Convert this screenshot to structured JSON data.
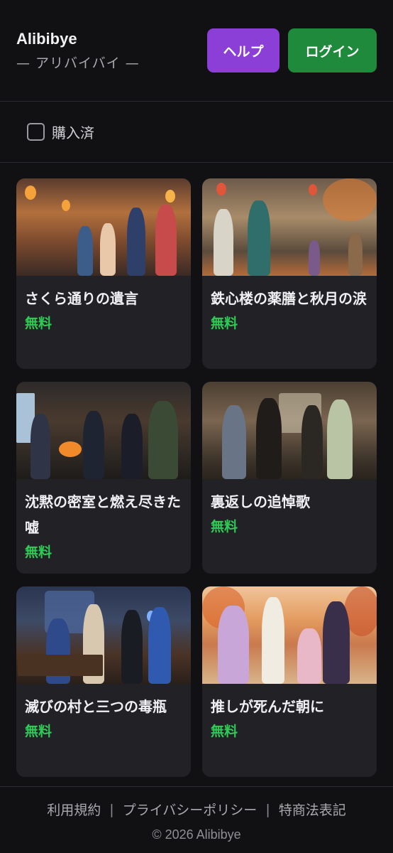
{
  "header": {
    "brand_name": "Alibibye",
    "brand_sub": "— アリバイバイ —",
    "help_label": "ヘルプ",
    "login_label": "ログイン"
  },
  "filter": {
    "purchased_label": "購入済"
  },
  "cards": [
    {
      "title": "さくら通りの遺言",
      "price": "無料"
    },
    {
      "title": "鉄心楼の薬膳と秋月の涙",
      "price": "無料"
    },
    {
      "title": "沈黙の密室と燃え尽きた嘘",
      "price": "無料"
    },
    {
      "title": "裏返しの追悼歌",
      "price": "無料"
    },
    {
      "title": "滅びの村と三つの毒瓶",
      "price": "無料"
    },
    {
      "title": "推しが死んだ朝に",
      "price": "無料"
    }
  ],
  "footer": {
    "terms": "利用規約",
    "separator": "|",
    "privacy": "プライバシーポリシー",
    "commerce": "特商法表記",
    "copyright": "© 2026 Alibibye"
  },
  "colors": {
    "background": "#111113",
    "card": "#222226",
    "help_button": "#8b3fd6",
    "login_button": "#1f8a3b",
    "price_green": "#2ecc55"
  }
}
